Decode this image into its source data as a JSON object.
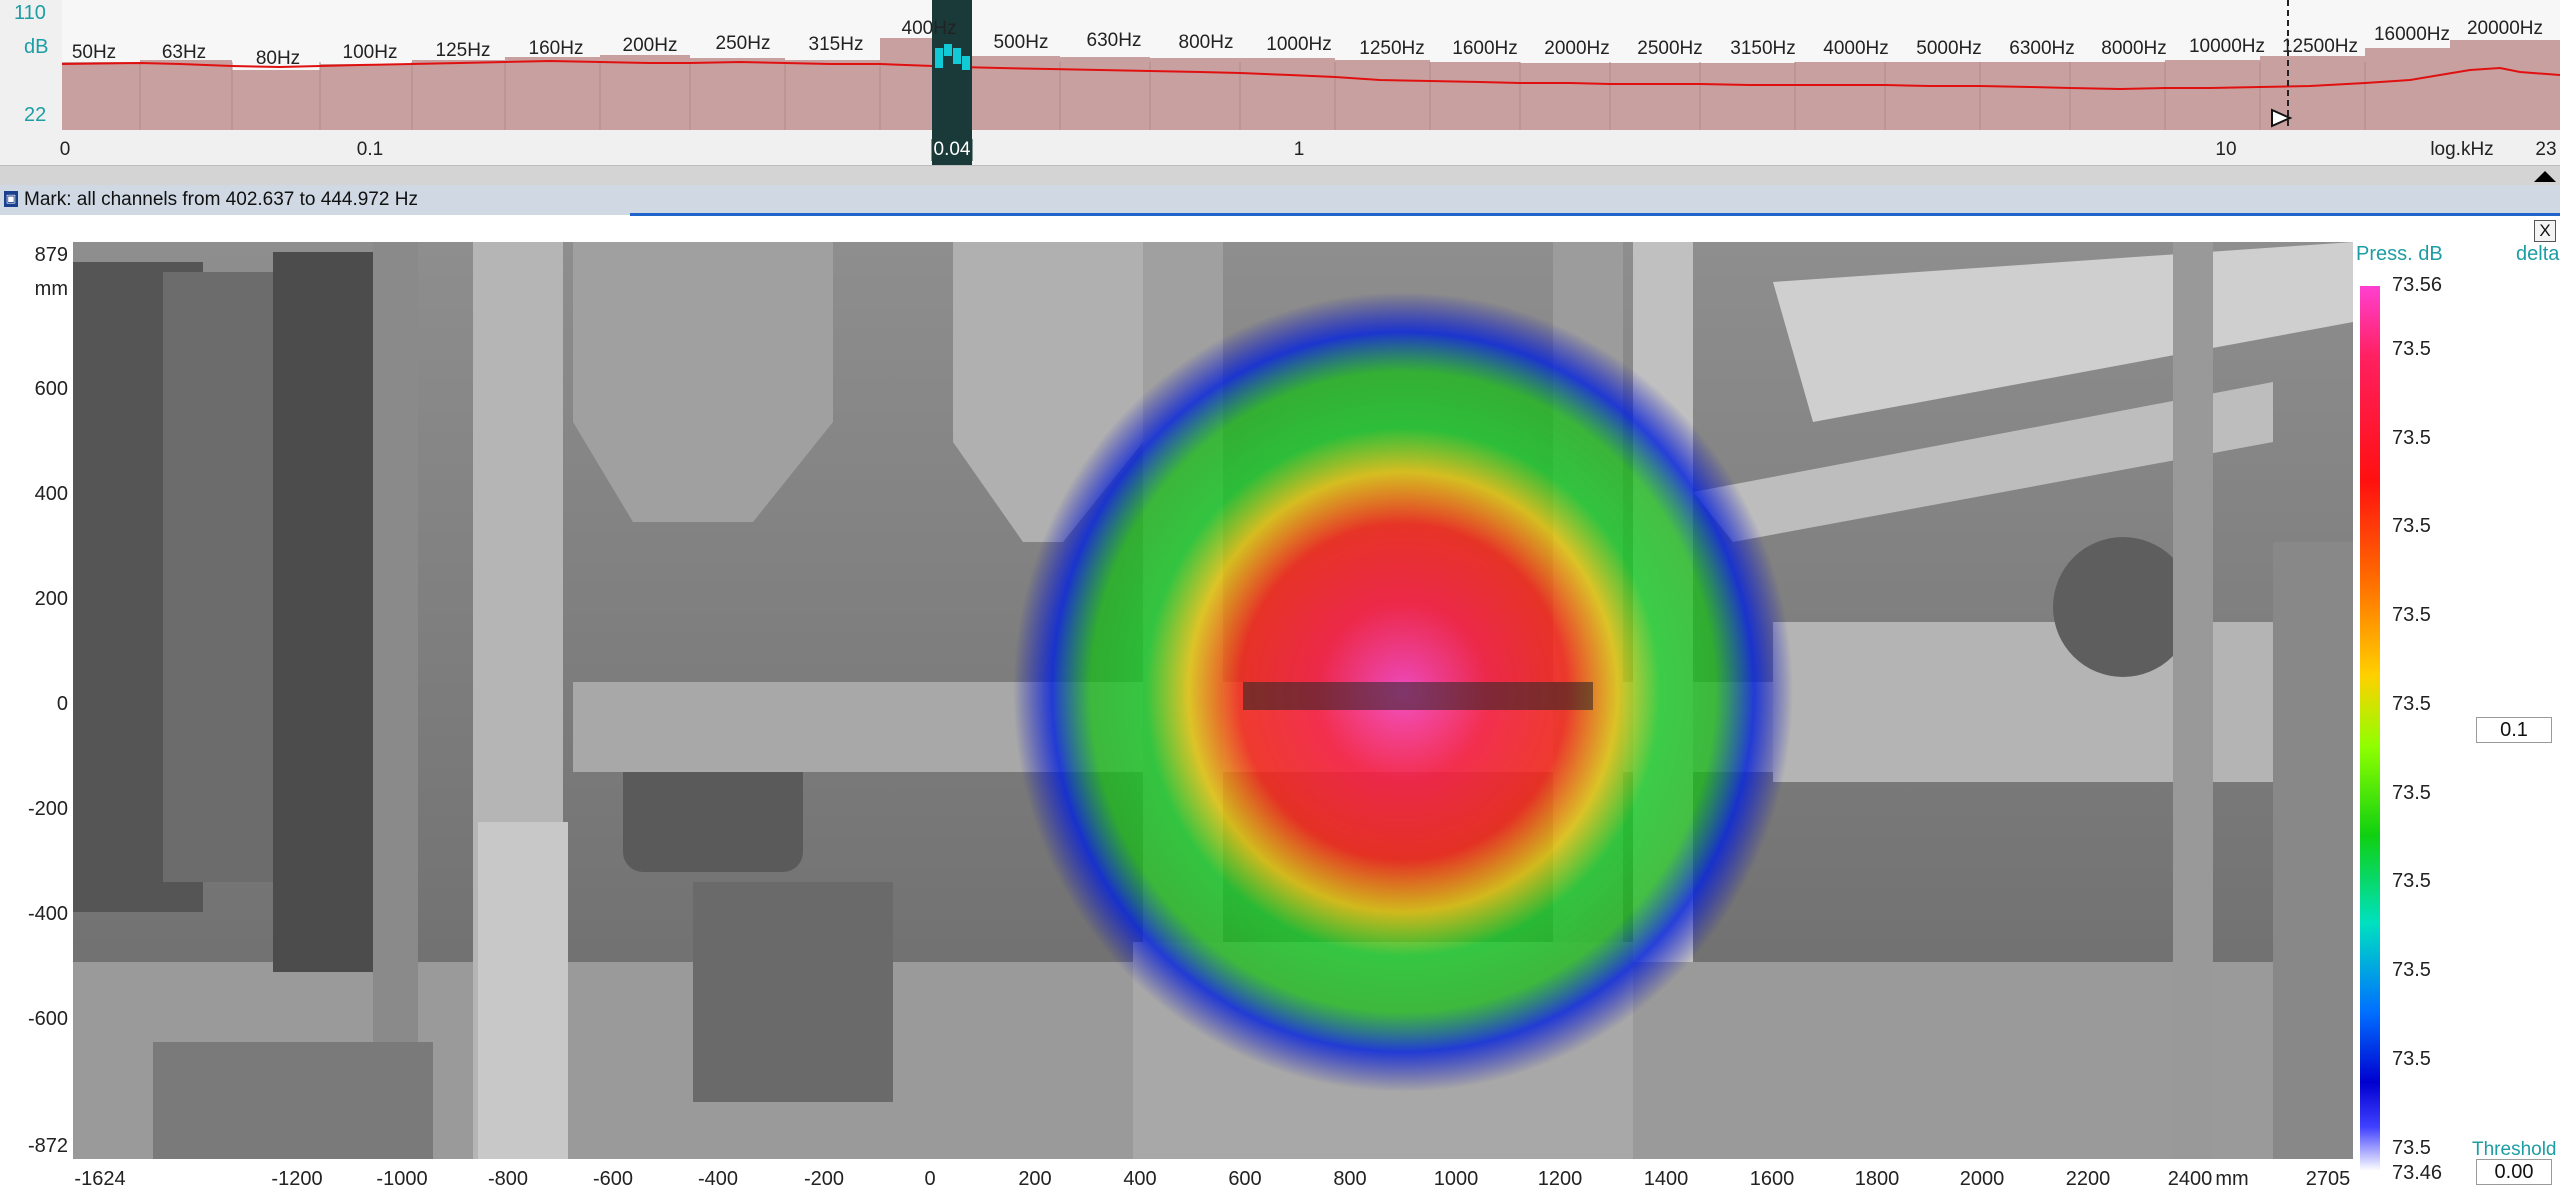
{
  "spectrum": {
    "db_max": "110",
    "db_unit": "dB",
    "db_min": "22",
    "bands": [
      "50Hz",
      "63Hz",
      "80Hz",
      "100Hz",
      "125Hz",
      "160Hz",
      "200Hz",
      "250Hz",
      "315Hz",
      "400Hz",
      "500Hz",
      "630Hz",
      "800Hz",
      "1000Hz",
      "1250Hz",
      "1600Hz",
      "2000Hz",
      "2500Hz",
      "3150Hz",
      "4000Hz",
      "5000Hz",
      "6300Hz",
      "8000Hz",
      "10000Hz",
      "12500Hz",
      "16000Hz",
      "20000Hz"
    ],
    "khz_ticks": [
      "0",
      "0.1",
      "0.04",
      "1",
      "10",
      "23"
    ],
    "axis_unit": "log.kHz",
    "colors": {
      "fill": "#c9a0a0",
      "curve": "#e01010",
      "selection": "#1a3a3a",
      "selection_mark": "#12c9d6"
    }
  },
  "mark": {
    "text": "Mark: all channels from 402.637 to 444.972 Hz",
    "close_label": "X",
    "lock_icon": "lock-icon"
  },
  "image": {
    "y_top": "879",
    "y_unit": "mm",
    "y_ticks": [
      "600",
      "400",
      "200",
      "0",
      "-200",
      "-400",
      "-600"
    ],
    "y_bottom": "-872",
    "x_left": "-1624",
    "x_ticks": [
      "-1200",
      "-1000",
      "-800",
      "-600",
      "-400",
      "-200",
      "0",
      "200",
      "400",
      "600",
      "800",
      "1000",
      "1200",
      "1400",
      "1600",
      "1800",
      "2000",
      "2200",
      "2400"
    ],
    "x_unit": "mm",
    "x_right": "2705"
  },
  "scale": {
    "title": "Press. dB",
    "delta_label": "delta",
    "max": "73.56",
    "steps": [
      "73.5",
      "73.5",
      "73.5",
      "73.5",
      "73.5",
      "73.5",
      "73.5",
      "73.5",
      "73.5",
      "73.5"
    ],
    "min": "73.46",
    "delta_value": "0.1",
    "threshold_label": "Threshold",
    "threshold_value": "0.00"
  }
}
